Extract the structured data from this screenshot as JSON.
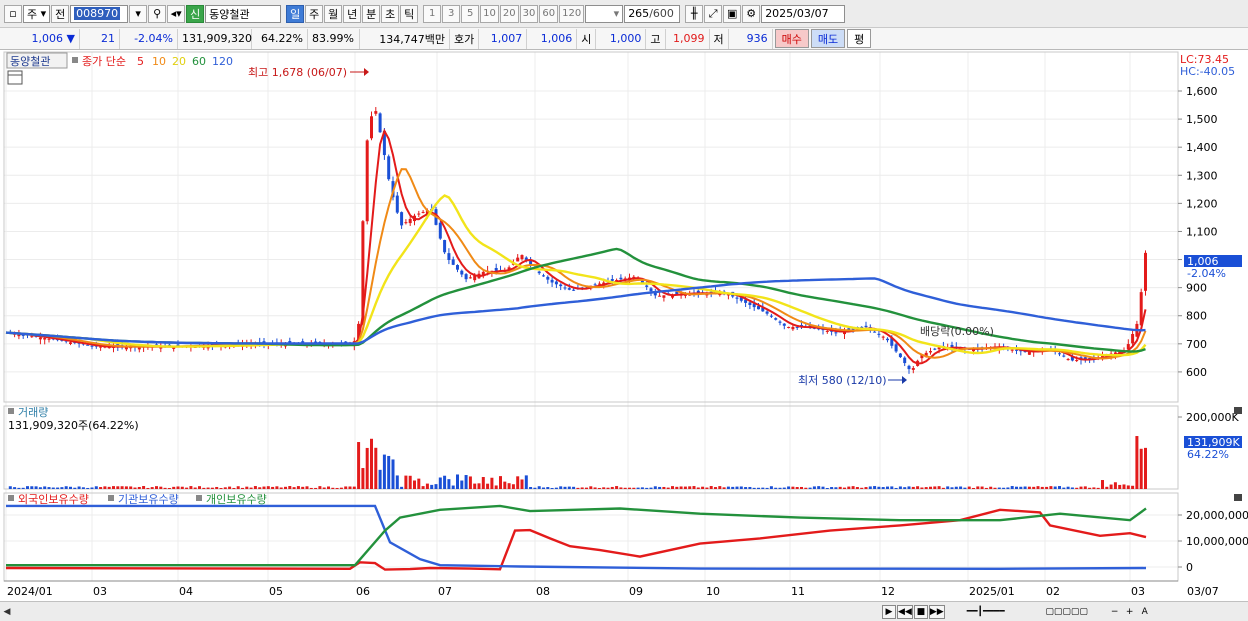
{
  "toolbar": {
    "market_select": "주",
    "prev_label": "전",
    "code": "008970",
    "badge_new": "신",
    "stock_name": "동양철관",
    "periods": [
      "일",
      "주",
      "월",
      "년",
      "분",
      "초",
      "틱"
    ],
    "active_period": "일",
    "numbers": [
      "1",
      "3",
      "5",
      "10",
      "20",
      "30",
      "60",
      "120"
    ],
    "count": "265",
    "count_total": "/600",
    "date": "2025/03/07"
  },
  "quote": {
    "price": "1,006",
    "change_arrow": "▼",
    "change": "21",
    "change_pct": "-2.04%",
    "volume": "131,909,320",
    "vol_ratio": "64.22%",
    "turnover": "83.99%",
    "amount": "134,747백만",
    "hoga_label": "호가",
    "ask": "1,007",
    "bid": "1,006",
    "open_label": "시",
    "open": "1,000",
    "high_label": "고",
    "high": "1,099",
    "low_label": "저",
    "low": "936",
    "buy_label": "매수",
    "sell_label": "매도",
    "eval_label": "평"
  },
  "chart": {
    "stock_tab": "동양철관",
    "ma_title": "종가 단순",
    "ma_periods": [
      "5",
      "10",
      "20",
      "60",
      "120"
    ],
    "ma_colors": [
      "#e31b1b",
      "#f08a16",
      "#f2e41a",
      "#23913c",
      "#2f5fd8"
    ],
    "lc_label": "LC:73.45",
    "hc_label": "HC:-40.05",
    "high_annotation": "최고 1,678 (06/07)",
    "low_annotation": "최저 580 (12/10)",
    "dividend_annotation": "배당락(0.00%)",
    "price_tag": "1,006",
    "price_tag_pct": "-2.04%",
    "price_ticks": [
      "1,600",
      "1,500",
      "1,400",
      "1,300",
      "1,200",
      "1,100",
      "1,000",
      "900",
      "800",
      "700",
      "600"
    ],
    "volume_title": "거래량",
    "volume_value": "131,909,320주(64.22%)",
    "volume_ticks": [
      "200,000K"
    ],
    "volume_tag": "131,909K",
    "volume_tag_pct": "64.22%",
    "holdings_labels": [
      "외국인보유수량",
      "기관보유수량",
      "개인보유수량"
    ],
    "holdings_colors": [
      "#e31b1b",
      "#2f5fd8",
      "#23913c"
    ],
    "holdings_ticks": [
      "20,000,000",
      "10,000,000",
      "0"
    ],
    "x_labels": [
      "2024/01",
      "03",
      "04",
      "05",
      "06",
      "07",
      "08",
      "09",
      "10",
      "11",
      "12",
      "2025/01",
      "02",
      "03",
      "03/07"
    ],
    "up_color": "#e31b1b",
    "down_color": "#1a4fd6"
  }
}
